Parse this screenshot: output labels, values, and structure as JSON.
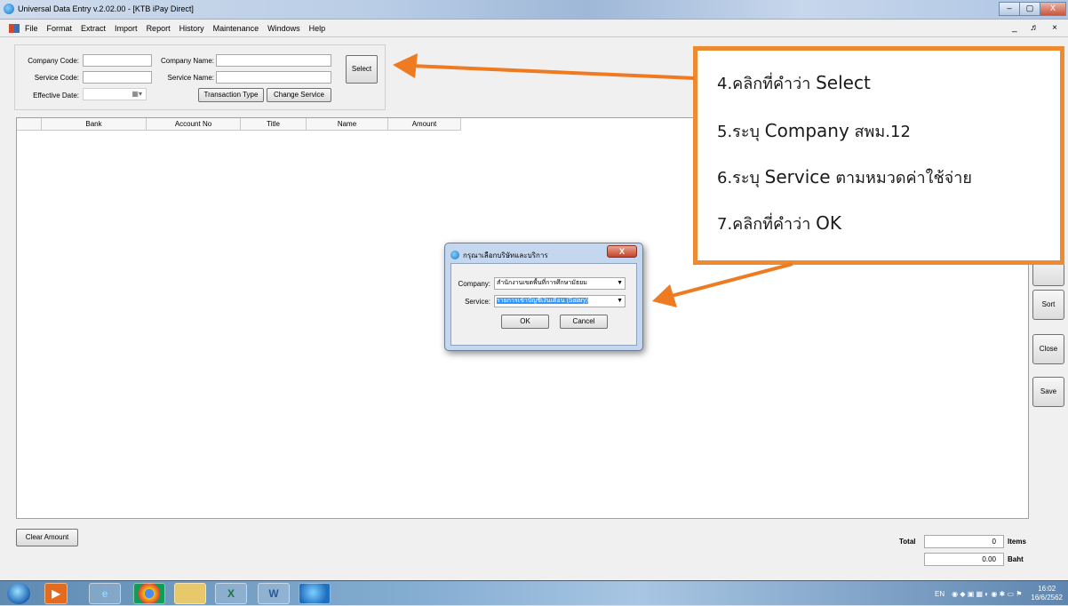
{
  "window": {
    "title": "Universal Data Entry v.2.02.00 - [KTB iPay Direct]",
    "min_glyph": "–",
    "max_glyph": "▢",
    "close_glyph": "X"
  },
  "menu": {
    "items": [
      "File",
      "Format",
      "Extract",
      "Import",
      "Report",
      "History",
      "Maintenance",
      "Windows",
      "Help"
    ],
    "mdi_controls": "_ ♬ ×"
  },
  "form": {
    "company_code_label": "Company Code:",
    "company_name_label": "Company Name:",
    "service_code_label": "Service Code:",
    "service_name_label": "Service Name:",
    "effective_date_label": "Effective Date:",
    "date_picker_glyph": "▦▾",
    "select_button": "Select",
    "transaction_type_button": "Transaction Type",
    "change_service_button": "Change Service"
  },
  "grid": {
    "columns": [
      "Bank",
      "Account No",
      "Title",
      "Name",
      "Amount"
    ]
  },
  "side_buttons": [
    "Sort",
    "Close",
    "Save"
  ],
  "bottom": {
    "clear_amount_button": "Clear Amount",
    "total_label": "Total",
    "items_value": "0",
    "items_label": "Items",
    "baht_value": "0.00",
    "baht_label": "Baht"
  },
  "dialog": {
    "title": "กรุณาเลือกบริษัทและบริการ",
    "close_glyph": "X",
    "company_label": "Company:",
    "company_value": "สำนักงานเขตพื้นที่การศึกษามัธยม",
    "service_label": "Service:",
    "service_value": "รายการเข้าบัญชีเงินเดือน (Salary)",
    "ok_button": "OK",
    "cancel_button": "Cancel"
  },
  "callout": {
    "lines": [
      {
        "prefix": "4.คลิกที่คำว่า ",
        "highlight": "Select",
        "suffix": ""
      },
      {
        "prefix": "5.ระบุ ",
        "highlight": "Company",
        "suffix": "   สพม.12"
      },
      {
        "prefix": "6.ระบุ ",
        "highlight": "Service",
        "suffix": "  ตามหมวดค่าใช้จ่าย"
      },
      {
        "prefix": "7.คลิกที่คำว่า ",
        "highlight": "OK",
        "suffix": ""
      }
    ]
  },
  "colors": {
    "callout_border": "#ee8a2f",
    "arrow": "#ee7a22",
    "dialog_frame": "#c5d7ee",
    "selection": "#3399ff"
  },
  "taskbar": {
    "apps": [
      "windows-start",
      "media-player",
      "internet-explorer",
      "chrome",
      "file-explorer",
      "excel",
      "word",
      "ktb-app"
    ],
    "excel_glyph": "X",
    "word_glyph": "W",
    "ie_glyph": "e",
    "language": "EN",
    "time": "16:02",
    "date": "16/6/2562"
  }
}
